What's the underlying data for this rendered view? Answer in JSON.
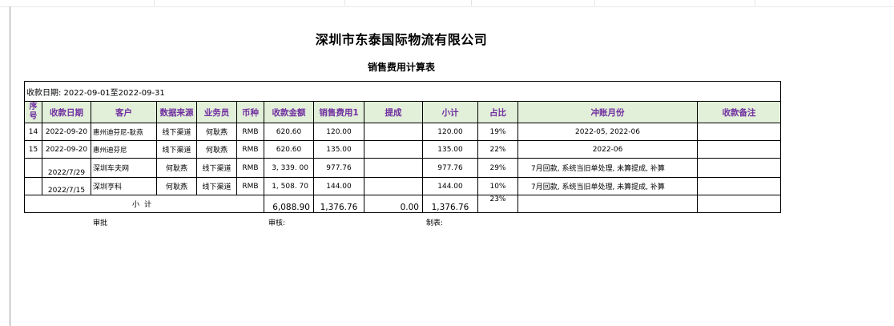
{
  "company": "深圳市东泰国际物流有限公司",
  "report_title": "销售费用计算表",
  "date_range": "收款日期: 2022-09-01至2022-09-31",
  "columns": [
    "序号",
    "收款日期",
    "客户",
    "数据来源",
    "业务员",
    "币种",
    "收款金额",
    "销售费用1",
    "提成",
    "小计",
    "占比",
    "冲账月份",
    "收款备注"
  ],
  "rows": [
    {
      "seq": "14",
      "date": "2022-09-20",
      "client": "惠州迪芬尼-耿燕",
      "source": "线下渠道",
      "sales": "何耿燕",
      "currency": "RMB",
      "amount": "620.60",
      "fee1": "120.00",
      "commission": "",
      "subtotal": "120.00",
      "ratio": "19%",
      "offset": "2022-05, 2022-06",
      "remark": ""
    },
    {
      "seq": "15",
      "date": "2022-09-20",
      "client": "惠州迪芬尼",
      "source": "线下渠道",
      "sales": "何耿燕",
      "currency": "RMB",
      "amount": "620.60",
      "fee1": "135.00",
      "commission": "",
      "subtotal": "135.00",
      "ratio": "22%",
      "offset": "2022-06",
      "remark": ""
    },
    {
      "seq": "",
      "date": "2022/7/29",
      "client": "深圳车夫网",
      "source": "何耿燕",
      "sales": "线下渠道",
      "currency": "RMB",
      "amount": "3, 339. 00",
      "fee1": "977.76",
      "commission": "",
      "subtotal": "977.76",
      "ratio": "29%",
      "offset": "7月回款, 系统当旧单处理, 未算提成, 补算",
      "remark": ""
    },
    {
      "seq": "",
      "date": "2022/7/15",
      "client": "深圳亨科",
      "source": "何耿燕",
      "sales": "线下渠道",
      "currency": "RMB",
      "amount": "1, 508. 70",
      "fee1": "144.00",
      "commission": "",
      "subtotal": "144.00",
      "ratio": "10%",
      "offset": "7月回款, 系统当旧单处理, 未算提成, 补算",
      "remark": ""
    }
  ],
  "total": {
    "label": "小计",
    "amount": "6,088.90",
    "fee1": "1,376.76",
    "commission": "0.00",
    "subtotal": "1,376.76",
    "ratio": "23%"
  },
  "signatures": {
    "approve": "审批",
    "review": "审核:",
    "prepare": "制表:"
  }
}
